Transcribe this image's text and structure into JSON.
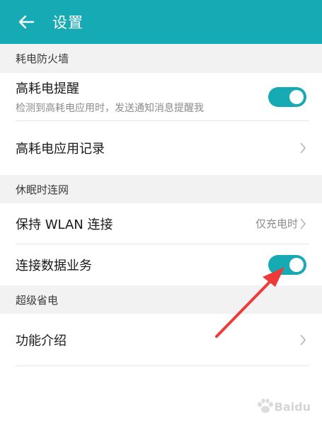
{
  "header": {
    "title": "设置",
    "back_icon": "arrow-left-icon"
  },
  "sections": {
    "power_firewall": {
      "title": "耗电防火墙",
      "high_power_alert": {
        "title": "高耗电提醒",
        "subtitle": "检测到高耗电应用时，发送通知消息提醒我",
        "enabled": true
      },
      "high_power_records": {
        "title": "高耗电应用记录"
      }
    },
    "sleep_connection": {
      "title": "休眠时连网",
      "keep_wlan": {
        "title": "保持 WLAN 连接",
        "value": "仅充电时"
      },
      "data_service": {
        "title": "连接数据业务",
        "enabled": true
      }
    },
    "super_saver": {
      "title": "超级省电",
      "feature_intro": {
        "title": "功能介绍"
      }
    }
  },
  "watermark": {
    "text": "Baidu"
  },
  "colors": {
    "accent": "#16aab4",
    "annotation": "#ee3a3a"
  }
}
